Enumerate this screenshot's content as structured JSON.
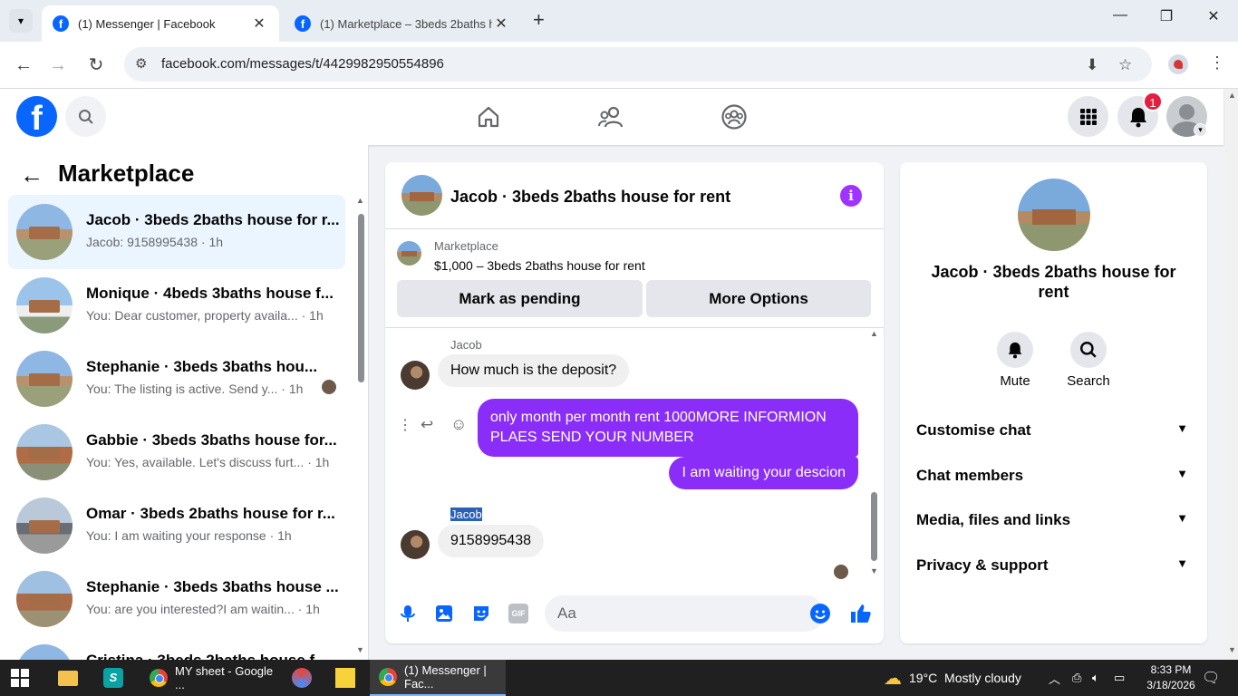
{
  "browser": {
    "tabs": [
      {
        "label": "(1) Messenger | Facebook",
        "active": true
      },
      {
        "label": "(1) Marketplace – 3beds 2baths ho",
        "active": false
      }
    ],
    "url": "facebook.com/messages/t/4429982950554896"
  },
  "fb_header": {
    "notifications_count": "1"
  },
  "left_panel": {
    "title": "Marketplace",
    "conversations": [
      {
        "name": "Jacob · 3beds 2baths house for r...",
        "snippet": "Jacob: 9158995438 · 1h",
        "selected": true
      },
      {
        "name": "Monique · 4beds 3baths house f...",
        "snippet": "You: Dear customer, property availa... · 1h"
      },
      {
        "name": "Stephanie · 3beds 3baths hou...",
        "snippet": "You: The listing is active. Send y... · 1h"
      },
      {
        "name": "Gabbie · 3beds 3baths house for...",
        "snippet": "You: Yes, available. Let's discuss furt... · 1h"
      },
      {
        "name": "Omar · 3beds 2baths house for r...",
        "snippet": "You: I am waiting your response · 1h"
      },
      {
        "name": "Stephanie · 3beds 3baths house ...",
        "snippet": "You: are you interested?I am waitin... · 1h"
      },
      {
        "name": "Cristina · 3beds 2baths house f...",
        "snippet": ""
      }
    ]
  },
  "chat": {
    "title": "Jacob · 3beds 2baths house for rent",
    "listing": {
      "label": "Marketplace",
      "price_title": "$1,000 – 3beds 2baths house for rent",
      "mark_pending": "Mark as pending",
      "more_options": "More Options"
    },
    "messages": [
      {
        "sender": "Jacob",
        "text": "How much is the deposit?",
        "direction": "in"
      },
      {
        "text": "only month per month rent 1000MORE INFORMION PLAES SEND YOUR NUMBER",
        "direction": "out"
      },
      {
        "text": "I am waiting your descion",
        "direction": "out"
      },
      {
        "sender": "Jacob",
        "text": "9158995438",
        "direction": "in"
      }
    ],
    "composer_placeholder": "Aa"
  },
  "details": {
    "name": "Jacob · 3beds 2baths house for rent",
    "actions": [
      {
        "label": "Mute",
        "icon": "bell-icon"
      },
      {
        "label": "Search",
        "icon": "search-icon"
      }
    ],
    "sections": [
      "Customise chat",
      "Chat members",
      "Media, files and links",
      "Privacy & support"
    ]
  },
  "taskbar": {
    "apps": [
      "MY sheet - Google ...",
      "(1) Messenger | Fac..."
    ],
    "weather": "19°C  Mostly cloudy",
    "time": "8:33 PM",
    "date": "3/18/2026"
  },
  "colors": {
    "fb_blue": "#0866ff",
    "bubble_out": "#8a2df8",
    "selected_bg": "#ebf5ff"
  }
}
